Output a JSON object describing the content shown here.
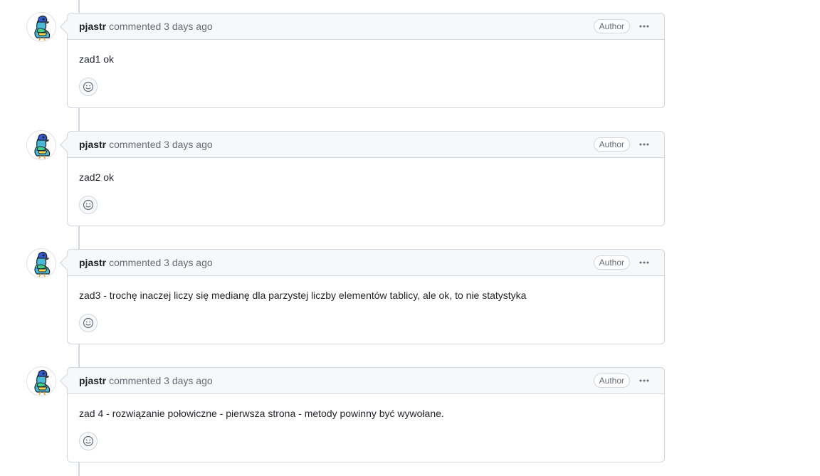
{
  "comments": [
    {
      "author": "pjastr",
      "meta": "commented 3 days ago",
      "badge": "Author",
      "body": "zad1 ok"
    },
    {
      "author": "pjastr",
      "meta": "commented 3 days ago",
      "badge": "Author",
      "body": "zad2 ok"
    },
    {
      "author": "pjastr",
      "meta": "commented 3 days ago",
      "badge": "Author",
      "body": "zad3 - trochę inaczej liczy się medianę dla parzystej liczby elementów tablicy, ale ok, to nie statystyka"
    },
    {
      "author": "pjastr",
      "meta": "commented 3 days ago",
      "badge": "Author",
      "body": "zad 4 - rozwiązanie połowiczne - pierwsza strona - metody powinny być wywołane."
    }
  ],
  "icons": {
    "avatar": "pigeon-avatar-icon",
    "menu": "kebab-horizontal-icon",
    "reaction": "smiley-icon"
  },
  "colors": {
    "border": "#d0d7de",
    "header_bg": "#f6f8fa",
    "muted_text": "#656d76",
    "text": "#1f2328"
  }
}
